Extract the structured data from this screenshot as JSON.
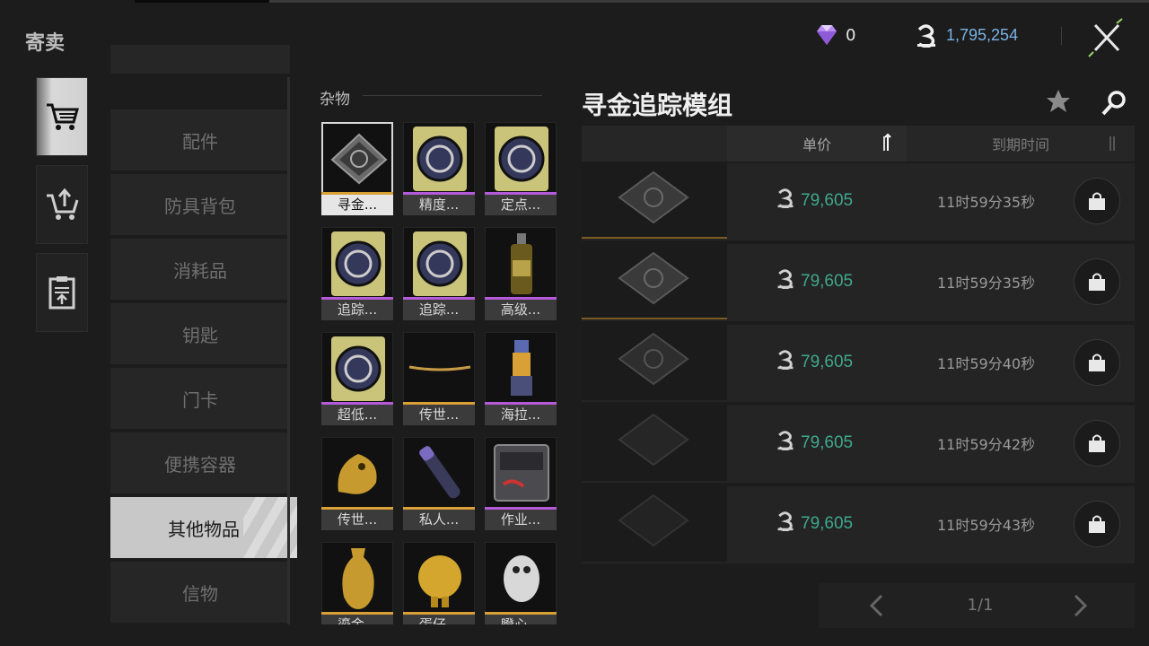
{
  "header": {
    "title": "寄卖",
    "gems": "0",
    "currency": "1,795,254"
  },
  "side_nav": {
    "items": [
      {
        "icon": "cart-icon",
        "active": true
      },
      {
        "icon": "cart-upload-icon",
        "active": false
      },
      {
        "icon": "clipboard-upload-icon",
        "active": false
      }
    ]
  },
  "categories": {
    "items": [
      {
        "label": "配件"
      },
      {
        "label": "防具背包"
      },
      {
        "label": "消耗品"
      },
      {
        "label": "钥匙"
      },
      {
        "label": "门卡"
      },
      {
        "label": "便携容器"
      },
      {
        "label": "其他物品",
        "active": true
      },
      {
        "label": "信物"
      }
    ]
  },
  "item_grid": {
    "heading": "杂物",
    "items": [
      {
        "label": "寻金...",
        "rarity": "gold",
        "selected": true
      },
      {
        "label": "精度...",
        "rarity": "purple"
      },
      {
        "label": "定点...",
        "rarity": "purple"
      },
      {
        "label": "追踪...",
        "rarity": "purple"
      },
      {
        "label": "追踪...",
        "rarity": "purple"
      },
      {
        "label": "高级...",
        "rarity": "purple"
      },
      {
        "label": "超低...",
        "rarity": "purple"
      },
      {
        "label": "传世...",
        "rarity": "gold"
      },
      {
        "label": "海拉...",
        "rarity": "purple"
      },
      {
        "label": "传世...",
        "rarity": "gold"
      },
      {
        "label": "私人...",
        "rarity": "gold"
      },
      {
        "label": "作业...",
        "rarity": "purple"
      },
      {
        "label": "鎏金...",
        "rarity": "gold"
      },
      {
        "label": "蛋仔...",
        "rarity": "gold"
      },
      {
        "label": "瞪心...",
        "rarity": "gold"
      }
    ]
  },
  "detail": {
    "title": "寻金追踪模组",
    "col_price": "单价",
    "col_time": "到期时间",
    "listings": [
      {
        "price": "79,605",
        "time": "11时59分35秒"
      },
      {
        "price": "79,605",
        "time": "11时59分35秒"
      },
      {
        "price": "79,605",
        "time": "11时59分40秒"
      },
      {
        "price": "79,605",
        "time": "11时59分42秒"
      },
      {
        "price": "79,605",
        "time": "11时59分43秒"
      }
    ],
    "page": "1/1"
  },
  "colors": {
    "price": "#3fa88b",
    "currency": "#7ab3e6",
    "gold": "#d9a036",
    "purple": "#b55bd9"
  }
}
